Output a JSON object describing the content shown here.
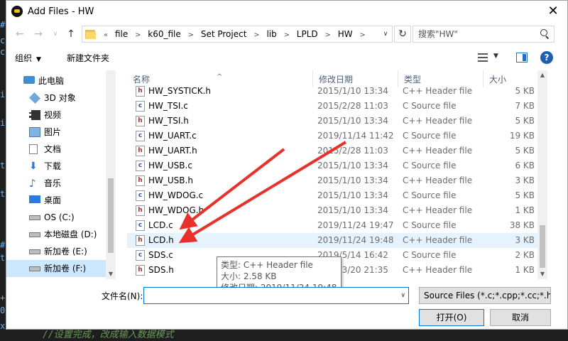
{
  "window": {
    "title": "Add Files - HW",
    "close": "✕"
  },
  "address": {
    "overflow": "«",
    "crumbs": [
      "file",
      "k60_file",
      "Set Project",
      "lib",
      "LPLD",
      "HW"
    ],
    "search_placeholder": "搜索\"HW\""
  },
  "toolbar": {
    "organize": "组织",
    "new_folder": "新建文件夹"
  },
  "nav_pane": {
    "items": [
      {
        "label": "此电脑",
        "icon": "computer-icon"
      },
      {
        "label": "3D 对象",
        "icon": "cube-icon"
      },
      {
        "label": "视频",
        "icon": "video-icon"
      },
      {
        "label": "图片",
        "icon": "picture-icon"
      },
      {
        "label": "文档",
        "icon": "document-icon"
      },
      {
        "label": "下载",
        "icon": "download-icon"
      },
      {
        "label": "音乐",
        "icon": "music-icon"
      },
      {
        "label": "桌面",
        "icon": "desktop-icon"
      },
      {
        "label": "OS (C:)",
        "icon": "drive-icon"
      },
      {
        "label": "本地磁盘 (D:)",
        "icon": "drive-icon"
      },
      {
        "label": "新加卷 (E:)",
        "icon": "drive-icon"
      },
      {
        "label": "新加卷 (F:)",
        "icon": "drive-icon"
      }
    ]
  },
  "columns": {
    "name": "名称",
    "date": "修改日期",
    "type": "类型",
    "size": "大小"
  },
  "files": [
    {
      "name": "HW_SYSTICK.h",
      "date": "2015/1/10 13:34",
      "type": "C++ Header file",
      "size": "5 KB",
      "kind": "h"
    },
    {
      "name": "HW_TSI.c",
      "date": "2015/2/28 11:03",
      "type": "C Source file",
      "size": "7 KB",
      "kind": "c"
    },
    {
      "name": "HW_TSI.h",
      "date": "2015/1/10 13:34",
      "type": "C++ Header file",
      "size": "5 KB",
      "kind": "h"
    },
    {
      "name": "HW_UART.c",
      "date": "2019/11/14 11:42",
      "type": "C Source file",
      "size": "19 KB",
      "kind": "c"
    },
    {
      "name": "HW_UART.h",
      "date": "2015/2/28 11:03",
      "type": "C++ Header file",
      "size": "5 KB",
      "kind": "h"
    },
    {
      "name": "HW_USB.c",
      "date": "2015/1/10 13:34",
      "type": "C Source file",
      "size": "6 KB",
      "kind": "c"
    },
    {
      "name": "HW_USB.h",
      "date": "2015/1/10 13:34",
      "type": "C++ Header file",
      "size": "3 KB",
      "kind": "h"
    },
    {
      "name": "HW_WDOG.c",
      "date": "2015/1/10 13:34",
      "type": "C Source file",
      "size": "5 KB",
      "kind": "c"
    },
    {
      "name": "HW_WDOG.h",
      "date": "2015/1/10 13:34",
      "type": "C++ Header file",
      "size": "1 KB",
      "kind": "h"
    },
    {
      "name": "LCD.c",
      "date": "2019/11/24 19:47",
      "type": "C Source file",
      "size": "38 KB",
      "kind": "c"
    },
    {
      "name": "LCD.h",
      "date": "2019/11/24 19:48",
      "type": "C++ Header file",
      "size": "3 KB",
      "kind": "h"
    },
    {
      "name": "SDS.c",
      "date": "2019/5/14 16:42",
      "type": "C Source file",
      "size": "2 KB",
      "kind": "c"
    },
    {
      "name": "SDS.h",
      "date": "2019/3/20 21:35",
      "type": "C++ Header file",
      "size": "1 KB",
      "kind": "h"
    }
  ],
  "tooltip": {
    "type": "类型: C++ Header file",
    "size": "大小: 2.58 KB",
    "date": "修改日期: 2019/11/24 19:48"
  },
  "bottom": {
    "filename_label": "文件名(N):",
    "filename_value": "",
    "filter": "Source Files (*.c;*.cpp;*.cc;*.h",
    "open": "打开(O)",
    "cancel": "取消"
  },
  "background": {
    "comment": "//设置完成，改成输入数据模式"
  },
  "colors": {
    "accent": "#0078d7",
    "arrow": "#e8312a",
    "hover_row": "#e5f3ff",
    "selected_nav": "#cce8ff"
  }
}
